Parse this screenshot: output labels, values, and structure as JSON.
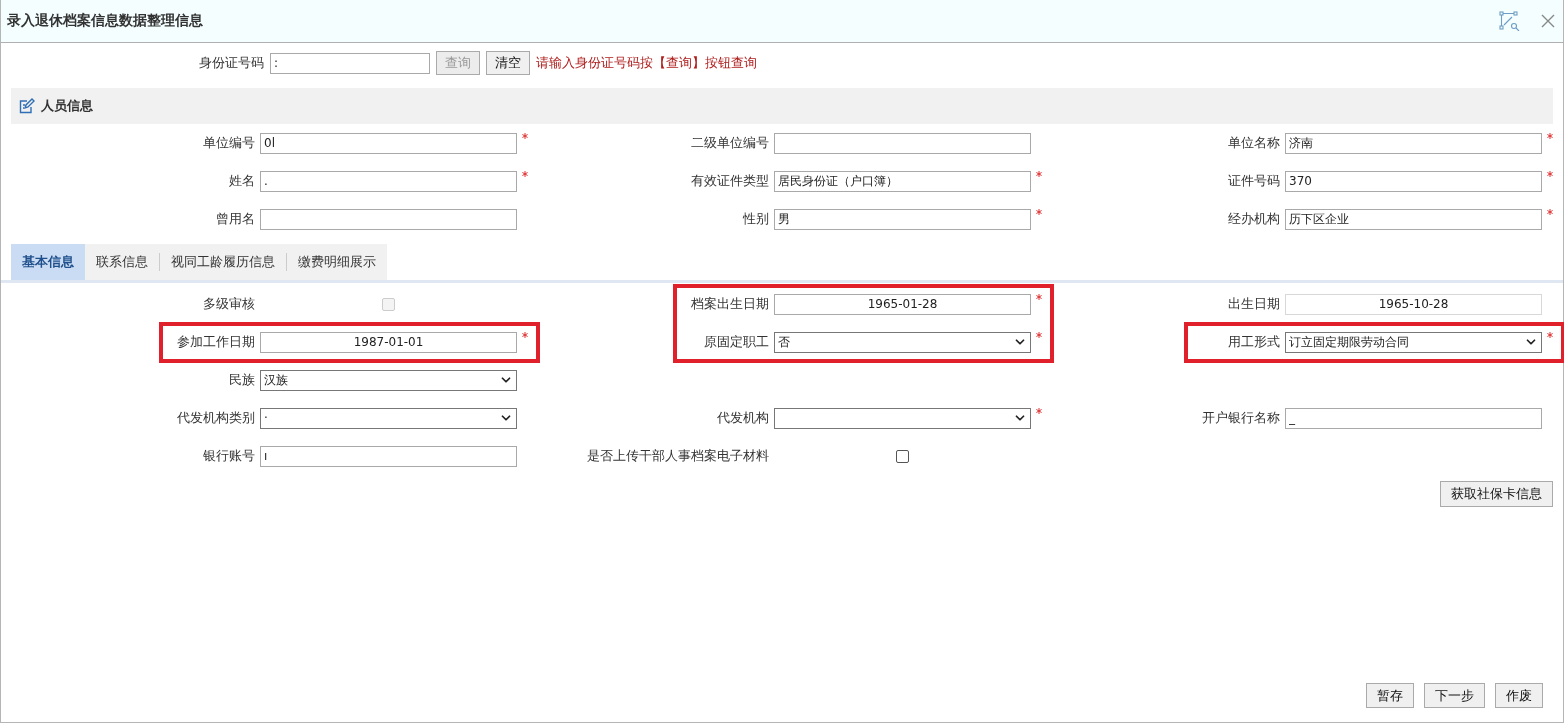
{
  "window": {
    "title": "录入退休档案信息数据整理信息"
  },
  "query": {
    "label": "身份证号码",
    "value": ":",
    "buttons": [
      {
        "label": "查询",
        "disabled": true
      },
      {
        "label": "清空",
        "disabled": false
      }
    ],
    "hint": "请输入身份证号码按【查询】按钮查询"
  },
  "section": {
    "title": "人员信息"
  },
  "person_rows": [
    [
      {
        "label": "单位编号",
        "kind": "text",
        "value": "0l",
        "required": true,
        "highlighted": false,
        "disabled": false
      },
      {
        "label": "二级单位编号",
        "kind": "text",
        "required": false,
        "highlighted": false,
        "disabled": false
      },
      {
        "label": "单位名称",
        "kind": "text",
        "value": "济南",
        "required": true,
        "highlighted": false,
        "disabled": false
      }
    ],
    [
      {
        "label": "姓名",
        "kind": "text",
        "value": ".",
        "required": true,
        "highlighted": false,
        "disabled": false
      },
      {
        "label": "有效证件类型",
        "kind": "text",
        "value": "居民身份证（户口簿）",
        "required": true,
        "highlighted": false,
        "disabled": false
      },
      {
        "label": "证件号码",
        "kind": "text",
        "value": "370",
        "required": true,
        "highlighted": false,
        "disabled": false
      }
    ],
    [
      {
        "label": "曾用名",
        "kind": "text",
        "required": false,
        "highlighted": false,
        "disabled": false
      },
      {
        "label": "性别",
        "kind": "text",
        "value": "男",
        "required": true,
        "highlighted": false,
        "disabled": false
      },
      {
        "label": "经办机构",
        "kind": "text",
        "value": "历下区企业",
        "required": true,
        "highlighted": false,
        "disabled": false
      }
    ]
  ],
  "tabs": [
    {
      "label": "基本信息",
      "selected": true
    },
    {
      "label": "联系信息",
      "selected": false
    },
    {
      "label": "视同工龄履历信息",
      "selected": false
    },
    {
      "label": "缴费明细展示",
      "selected": false
    }
  ],
  "basic_rows": [
    [
      {
        "label": "多级审核",
        "kind": "checkbox",
        "checked": false,
        "required": false,
        "highlighted": false,
        "disabled": true
      },
      {
        "label": "档案出生日期",
        "kind": "date",
        "value": "1965-01-28",
        "required": true,
        "highlighted": true,
        "disabled": false
      },
      {
        "label": "出生日期",
        "kind": "date",
        "value": "1965-10-28",
        "required": false,
        "highlighted": false,
        "disabled": true
      }
    ],
    [
      {
        "label": "参加工作日期",
        "kind": "date",
        "value": "1987-01-01",
        "required": true,
        "highlighted": true,
        "disabled": false
      },
      {
        "label": "原固定职工",
        "kind": "select",
        "value": "否",
        "required": true,
        "highlighted": true,
        "disabled": false
      },
      {
        "label": "用工形式",
        "kind": "select",
        "value": "订立固定期限劳动合同",
        "required": true,
        "highlighted": true,
        "disabled": false
      }
    ],
    [
      {
        "label": "民族",
        "kind": "select",
        "value": "汉族",
        "required": false,
        "highlighted": false,
        "disabled": false
      },
      null,
      null
    ],
    [
      {
        "label": "代发机构类别",
        "kind": "select",
        "value": "·",
        "required": false,
        "highlighted": false,
        "disabled": false
      },
      {
        "label": "代发机构",
        "kind": "select",
        "required": true,
        "highlighted": false,
        "disabled": false
      },
      {
        "label": "开户银行名称",
        "kind": "text",
        "value": "_",
        "required": false,
        "highlighted": false,
        "disabled": false
      }
    ],
    [
      {
        "label": "银行账号",
        "kind": "text",
        "value": "ı",
        "required": false,
        "highlighted": false,
        "disabled": false
      },
      {
        "label": "是否上传干部人事档案电子材料",
        "kind": "checkbox",
        "checked": false,
        "required": false,
        "highlighted": false,
        "disabled": false
      },
      null
    ]
  ],
  "card_button": "获取社保卡信息",
  "footer_buttons": [
    "暂存",
    "下一步",
    "作废"
  ]
}
